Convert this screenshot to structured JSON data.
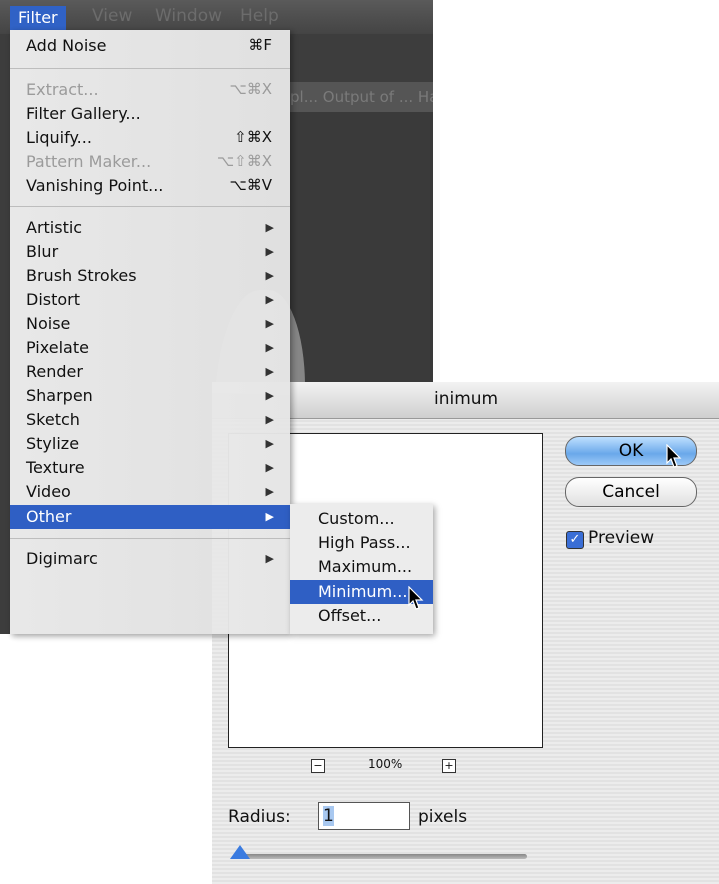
{
  "menubar": {
    "items": [
      "Filter",
      "View",
      "Window",
      "Help"
    ],
    "active": "Filter"
  },
  "background": {
    "document_title": "pl... Output of ... Harrison Selection Sm"
  },
  "filter_menu": {
    "top_items": [
      {
        "label": "Add Noise",
        "shortcut": "⌘F",
        "disabled": false
      }
    ],
    "group2": [
      {
        "label": "Extract...",
        "shortcut": "⌥⌘X",
        "disabled": true
      },
      {
        "label": "Filter Gallery...",
        "shortcut": "",
        "disabled": false
      },
      {
        "label": "Liquify...",
        "shortcut": "⇧⌘X",
        "disabled": false
      },
      {
        "label": "Pattern Maker...",
        "shortcut": "⌥⇧⌘X",
        "disabled": true
      },
      {
        "label": "Vanishing Point...",
        "shortcut": "⌥⌘V",
        "disabled": false
      }
    ],
    "submenus": [
      {
        "label": "Artistic"
      },
      {
        "label": "Blur"
      },
      {
        "label": "Brush Strokes"
      },
      {
        "label": "Distort"
      },
      {
        "label": "Noise"
      },
      {
        "label": "Pixelate"
      },
      {
        "label": "Render"
      },
      {
        "label": "Sharpen"
      },
      {
        "label": "Sketch"
      },
      {
        "label": "Stylize"
      },
      {
        "label": "Texture"
      },
      {
        "label": "Video"
      },
      {
        "label": "Other",
        "selected": true
      }
    ],
    "plugins": [
      {
        "label": "Digimarc"
      }
    ],
    "submenu_arrow": "▶"
  },
  "other_submenu": {
    "items": [
      {
        "label": "Custom...",
        "selected": false
      },
      {
        "label": "High Pass...",
        "selected": false
      },
      {
        "label": "Maximum...",
        "selected": false
      },
      {
        "label": "Minimum...",
        "selected": true
      },
      {
        "label": "Offset...",
        "selected": false
      }
    ]
  },
  "dialog": {
    "title": "inimum",
    "ok_label": "OK",
    "cancel_label": "Cancel",
    "preview_label": "Preview",
    "preview_checked": true,
    "zoom_level": "100%",
    "zoom_out": "−",
    "zoom_in": "+",
    "radius_label": "Radius:",
    "radius_value": "1",
    "radius_unit": "pixels",
    "checkmark": "✓"
  }
}
